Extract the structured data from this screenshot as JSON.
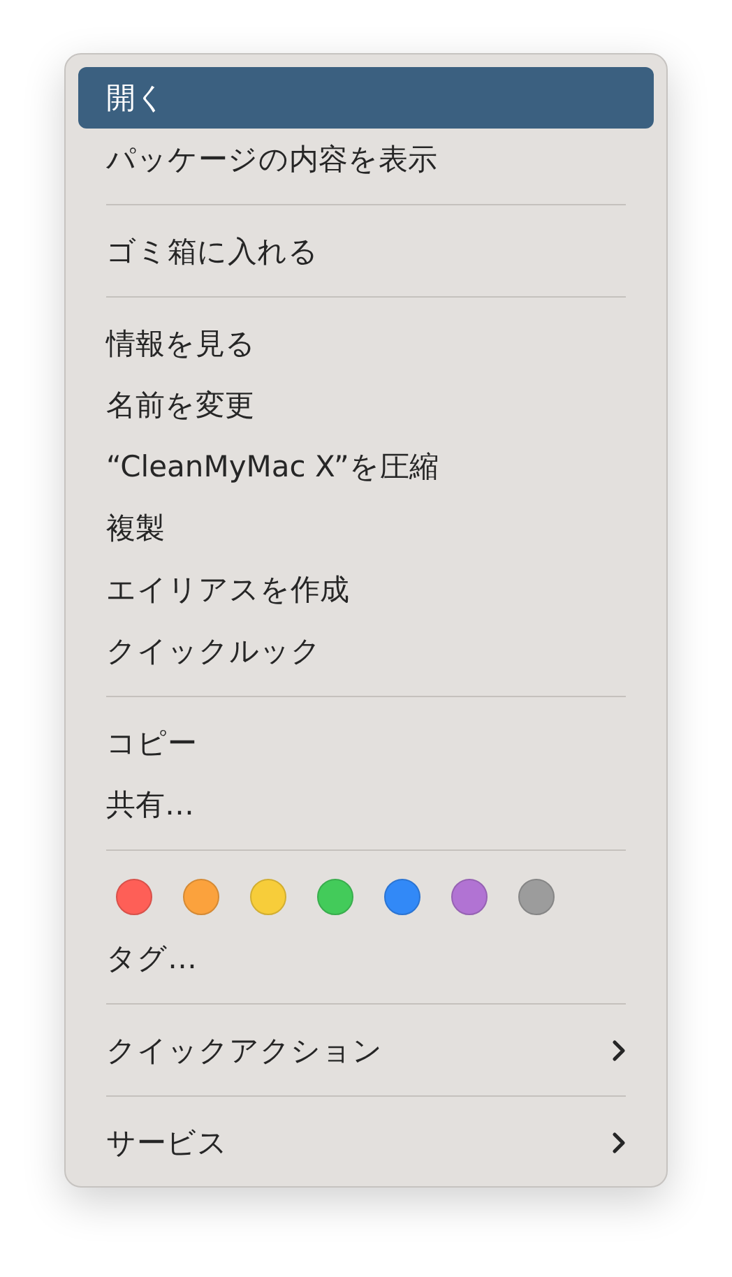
{
  "menu": {
    "sections": [
      {
        "items": [
          {
            "kind": "command",
            "label": "開く",
            "selected": true
          },
          {
            "kind": "command",
            "label": "パッケージの内容を表示",
            "selected": false
          }
        ]
      },
      {
        "items": [
          {
            "kind": "command",
            "label": "ゴミ箱に入れる",
            "selected": false
          }
        ]
      },
      {
        "items": [
          {
            "kind": "command",
            "label": "情報を見る",
            "selected": false
          },
          {
            "kind": "command",
            "label": "名前を変更",
            "selected": false
          },
          {
            "kind": "command",
            "label": "“CleanMyMac X”を圧縮",
            "selected": false
          },
          {
            "kind": "command",
            "label": "複製",
            "selected": false
          },
          {
            "kind": "command",
            "label": "エイリアスを作成",
            "selected": false
          },
          {
            "kind": "command",
            "label": "クイックルック",
            "selected": false
          }
        ]
      },
      {
        "items": [
          {
            "kind": "command",
            "label": "コピー",
            "selected": false
          },
          {
            "kind": "command",
            "label": "共有…",
            "selected": false
          }
        ]
      },
      {
        "items": [
          {
            "kind": "tags",
            "tags": [
              {
                "color": "#fe5f57"
              },
              {
                "color": "#fba23d"
              },
              {
                "color": "#f7cd3a"
              },
              {
                "color": "#43cb5a"
              },
              {
                "color": "#3289f7"
              },
              {
                "color": "#b173d3"
              },
              {
                "color": "#9c9c9c"
              }
            ]
          },
          {
            "kind": "command",
            "label": "タグ…",
            "selected": false
          }
        ]
      },
      {
        "items": [
          {
            "kind": "submenu",
            "label": "クイックアクション",
            "selected": false
          }
        ]
      },
      {
        "items": [
          {
            "kind": "submenu",
            "label": "サービス",
            "selected": false
          }
        ]
      }
    ]
  }
}
